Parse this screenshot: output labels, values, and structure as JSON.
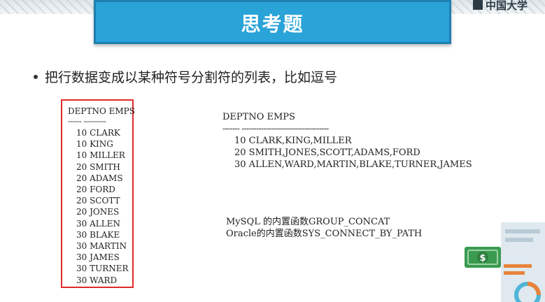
{
  "slide": {
    "title": "思考题",
    "corner_logo": "中国大学",
    "bullet_text": "把行数据变成以某种符号分割符的列表，比如逗号"
  },
  "left_table": {
    "header": "DEPTNO EMPS",
    "separator": "------ ----------",
    "rows": [
      "10 CLARK",
      "10 KING",
      "10 MILLER",
      "20 SMITH",
      "20 ADAMS",
      "20 FORD",
      "20 SCOTT",
      "20 JONES",
      "30 ALLEN",
      "30 BLAKE",
      "30 MARTIN",
      "30 JAMES",
      "30 TURNER",
      "30 WARD"
    ]
  },
  "right_table": {
    "header": "DEPTNO EMPS",
    "separator": "------- ------------------------------------",
    "rows": [
      "10 CLARK,KING,MILLER",
      "20 SMITH,JONES,SCOTT,ADAMS,FORD",
      "30 ALLEN,WARD,MARTIN,BLAKE,TURNER,JAMES"
    ]
  },
  "notes": [
    "MySQL 的内置函数GROUP_CONCAT",
    "Oracle的内置函数SYS_CONNECT_BY_PATH"
  ],
  "decoration": {
    "money_icon_glyph": "$",
    "colors": {
      "title_bg": "#2aa3d8",
      "border_red": "#e02b2b",
      "money_green": "#3a9b4e",
      "accent_orange": "#e8833a"
    }
  }
}
